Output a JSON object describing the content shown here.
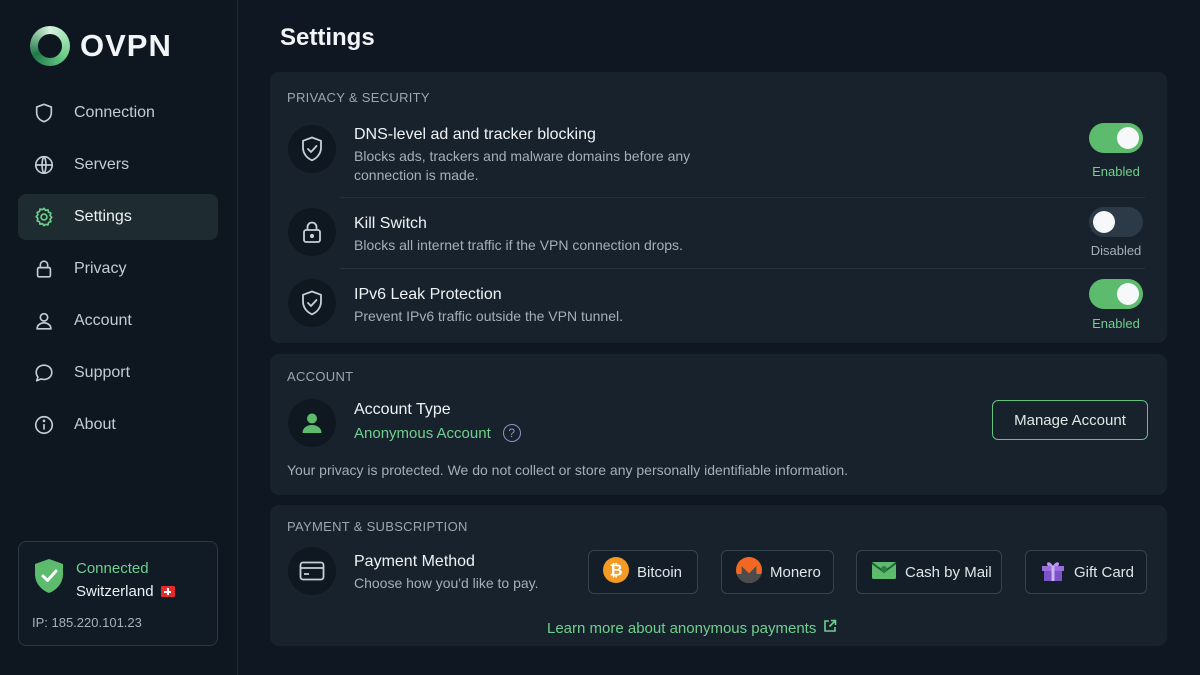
{
  "app": {
    "name": "OVPN"
  },
  "nav": {
    "items": [
      {
        "label": "Connection",
        "icon": "shield-icon",
        "active": false
      },
      {
        "label": "Servers",
        "icon": "globe-icon",
        "active": false
      },
      {
        "label": "Settings",
        "icon": "gear-icon",
        "active": true
      },
      {
        "label": "Privacy",
        "icon": "lock-icon",
        "active": false
      },
      {
        "label": "Account",
        "icon": "user-icon",
        "active": false
      },
      {
        "label": "Support",
        "icon": "chat-bubble-icon",
        "active": false
      },
      {
        "label": "About",
        "icon": "info-icon",
        "active": false
      }
    ]
  },
  "status": {
    "state": "Connected",
    "location": "Switzerland",
    "ip": "IP:  185.220.101.23"
  },
  "page": {
    "title": "Settings"
  },
  "privacy": {
    "title": "PRIVACY & SECURITY",
    "rows": [
      {
        "title": "DNS-level ad and tracker blocking",
        "desc1": "Blocks ads, trackers and malware domains before any",
        "desc2": "connection is made.",
        "state": "Enabled",
        "on": true
      },
      {
        "title": "Kill Switch",
        "desc1": "Blocks all internet traffic if the VPN connection drops.",
        "desc2": "",
        "state": "Disabled",
        "on": false
      },
      {
        "title": "IPv6 Leak Protection",
        "desc1": "Prevent IPv6 traffic outside the VPN tunnel.",
        "desc2": "",
        "state": "Enabled",
        "on": true
      }
    ]
  },
  "account": {
    "title": "ACCOUNT",
    "type_label": "Account Type",
    "type_value": "Anonymous Account",
    "help": "?",
    "manage": "Manage Account",
    "note": "Your privacy is protected. We do not collect or store any personally identifiable information."
  },
  "payment": {
    "title": "PAYMENT & SUBSCRIPTION",
    "method_label": "Payment Method",
    "method_desc": "Choose how you'd like to pay.",
    "options": [
      "Bitcoin",
      "Monero",
      "Cash by Mail",
      "Gift Card"
    ],
    "learn": "Learn more about anonymous payments"
  },
  "colors": {
    "accent": "#6fd08c",
    "toggle_on": "#5dbb6e",
    "panel": "#18222d",
    "background": "#0f1722"
  }
}
